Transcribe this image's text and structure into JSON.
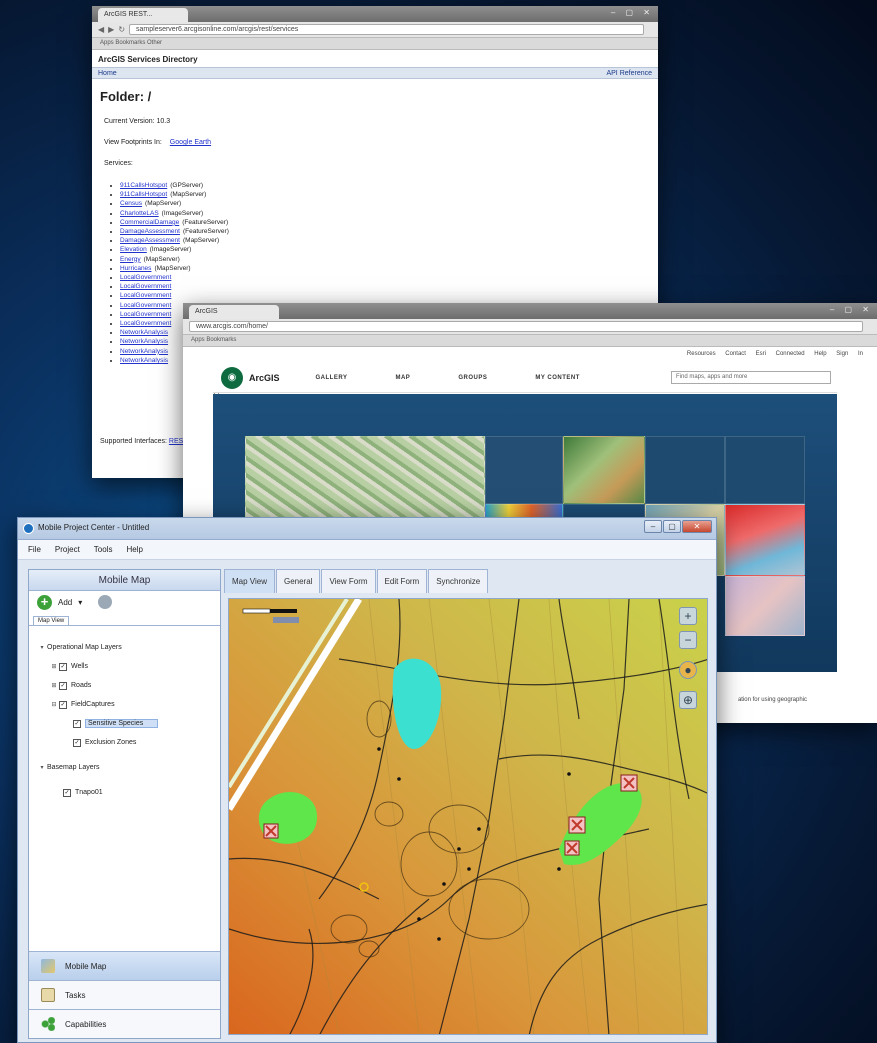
{
  "directory_window": {
    "tab_title": "ArcGIS REST...",
    "url": "sampleserver6.arcgisonline.com/arcgis/rest/services",
    "bookmarks": "Apps   Bookmarks   Other",
    "app_header": "ArcGIS Services Directory",
    "bar_left": "Home",
    "bar_right": "API Reference",
    "folder_title": "Folder: /",
    "version_label": "Current Version: 10.3",
    "view_footprints_label": "View Footprints In:",
    "view_footprints_link": "Google Earth",
    "services_label": "Services:",
    "services": [
      {
        "name": "911CallsHotspot",
        "type": "(GPServer)"
      },
      {
        "name": "911CallsHotspot",
        "type": "(MapServer)"
      },
      {
        "name": "Census",
        "type": "(MapServer)"
      },
      {
        "name": "CharlotteLAS",
        "type": "(ImageServer)"
      },
      {
        "name": "CommercialDamage",
        "type": "(FeatureServer)"
      },
      {
        "name": "DamageAssessment",
        "type": "(FeatureServer)"
      },
      {
        "name": "DamageAssessment",
        "type": "(MapServer)"
      },
      {
        "name": "Elevation",
        "type": "(ImageServer)"
      },
      {
        "name": "Energy",
        "type": "(MapServer)"
      },
      {
        "name": "Hurricanes",
        "type": "(MapServer)"
      },
      {
        "name": "LocalGovernment",
        "type": ""
      },
      {
        "name": "LocalGovernment",
        "type": ""
      },
      {
        "name": "LocalGovernment",
        "type": ""
      },
      {
        "name": "LocalGovernment",
        "type": ""
      },
      {
        "name": "LocalGovernment",
        "type": ""
      },
      {
        "name": "LocalGovernment",
        "type": ""
      },
      {
        "name": "NetworkAnalysis",
        "type": ""
      },
      {
        "name": "NetworkAnalysis",
        "type": ""
      },
      {
        "name": "NetworkAnalysis",
        "type": ""
      },
      {
        "name": "NetworkAnalysis",
        "type": ""
      }
    ],
    "supported_label": "Supported Interfaces:",
    "supported_link": "REST"
  },
  "agol_window": {
    "tab_title": "ArcGIS",
    "url": "www.arcgis.com/home/",
    "bookmarks": "Apps   Bookmarks",
    "toplinks": "Resources Contact  Esri Connected  Help  Sign In",
    "brand": "ArcGIS",
    "nav": [
      "GALLERY",
      "MAP",
      "GROUPS",
      "MY CONTENT"
    ],
    "search_placeholder": "Find maps, apps and more",
    "footer_text": "ation for using geographic"
  },
  "mpc_window": {
    "title": "Mobile Project Center - Untitled",
    "menu": [
      "File",
      "Project",
      "Tools",
      "Help"
    ],
    "left_header": "Mobile Map",
    "add_label": "Add",
    "map_view_tab": "Map View",
    "tree": {
      "operational": "Operational Map Layers",
      "layers": [
        "Wells",
        "Roads",
        "FieldCaptures"
      ],
      "sublayers": [
        "Sensitive Species",
        "Exclusion Zones"
      ],
      "basemap": "Basemap Layers",
      "basemap_layers": [
        "Tnapo01"
      ]
    },
    "bottom_buttons": [
      "Mobile Map",
      "Tasks",
      "Capabilities"
    ],
    "tabs": [
      "Map View",
      "General",
      "View Form",
      "Edit Form",
      "Synchronize"
    ],
    "active_tab": "Map View"
  },
  "colors": {
    "background": "#0a2f5d",
    "accent": "#3da13a",
    "map_feature_green": "#5ee64a",
    "map_feature_cyan": "#3ce0d0"
  }
}
